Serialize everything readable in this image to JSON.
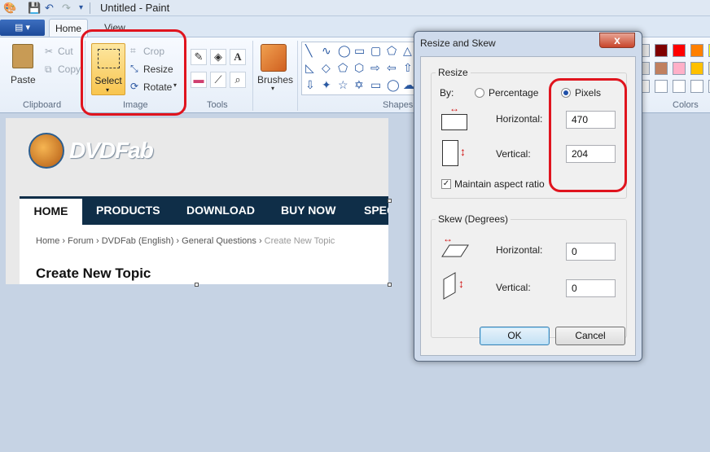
{
  "window": {
    "title": "Untitled - Paint"
  },
  "tabs": {
    "home": "Home",
    "view": "View",
    "app_menu_icon": "menu-icon"
  },
  "ribbon": {
    "clipboard": {
      "label": "Clipboard",
      "paste": "Paste",
      "cut": "Cut",
      "copy": "Copy"
    },
    "image": {
      "label": "Image",
      "select": "Select",
      "crop": "Crop",
      "resize": "Resize",
      "rotate": "Rotate"
    },
    "tools": {
      "label": "Tools"
    },
    "brushes": {
      "label": "Brushes"
    },
    "shapes": {
      "label": "Shapes"
    },
    "colors": {
      "label": "Colors",
      "swatches": [
        "#e5e5e5",
        "#7f0000",
        "#ff0000",
        "#ff8000",
        "#ffff00",
        "#d8d8d8",
        "#c08060",
        "#ffb0c8",
        "#ffc000",
        "#efe4b0",
        "#f0f0f0",
        "#ffffff",
        "#ffffff",
        "#ffffff",
        "#ffffff"
      ]
    }
  },
  "canvas": {
    "logo_text": "DVDFab",
    "nav": [
      "HOME",
      "PRODUCTS",
      "DOWNLOAD",
      "BUY NOW",
      "SPEC"
    ],
    "breadcrumb": [
      "Home",
      "Forum",
      "DVDFab (English)",
      "General Questions",
      "Create New Topic"
    ],
    "breadcrumb_sep": "›",
    "heading": "Create New Topic"
  },
  "dialog": {
    "title": "Resize and Skew",
    "close": "x",
    "resize": {
      "legend": "Resize",
      "by": "By:",
      "percentage": "Percentage",
      "pixels": "Pixels",
      "horizontal_label": "Horizontal:",
      "horizontal_value": "470",
      "vertical_label": "Vertical:",
      "vertical_value": "204",
      "maintain": "Maintain aspect ratio"
    },
    "skew": {
      "legend": "Skew (Degrees)",
      "horizontal_label": "Horizontal:",
      "horizontal_value": "0",
      "vertical_label": "Vertical:",
      "vertical_value": "0"
    },
    "ok": "OK",
    "cancel": "Cancel"
  }
}
